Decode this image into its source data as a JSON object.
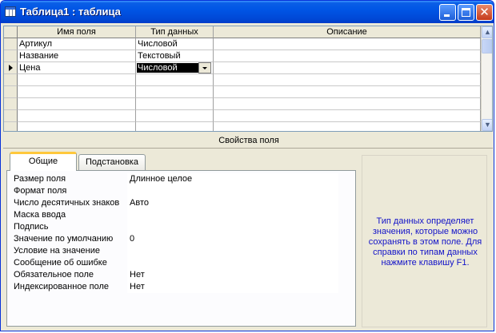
{
  "window": {
    "title": "Таблица1 : таблица"
  },
  "grid": {
    "headers": {
      "name": "Имя поля",
      "type": "Тип данных",
      "description": "Описание"
    },
    "rows": [
      {
        "name": "Артикул",
        "type": "Числовой",
        "description": ""
      },
      {
        "name": "Название",
        "type": "Текстовый",
        "description": ""
      },
      {
        "name": "Цена",
        "type": "Числовой",
        "description": ""
      }
    ],
    "current_row_index": 2
  },
  "properties": {
    "header": "Свойства поля",
    "tabs": [
      "Общие",
      "Подстановка"
    ],
    "active_tab": "Общие",
    "rows": [
      {
        "label": "Размер поля",
        "value": "Длинное целое"
      },
      {
        "label": "Формат поля",
        "value": ""
      },
      {
        "label": "Число десятичных знаков",
        "value": "Авто"
      },
      {
        "label": "Маска ввода",
        "value": ""
      },
      {
        "label": "Подпись",
        "value": ""
      },
      {
        "label": "Значение по умолчанию",
        "value": "0"
      },
      {
        "label": "Условие на значение",
        "value": ""
      },
      {
        "label": "Сообщение об ошибке",
        "value": ""
      },
      {
        "label": "Обязательное поле",
        "value": "Нет"
      },
      {
        "label": "Индексированное поле",
        "value": "Нет"
      }
    ],
    "help_text": "Тип данных определяет значения, которые можно сохранять в этом поле. Для справки по типам данных нажмите клавишу F1."
  },
  "colors": {
    "title_bar": "#0055e5",
    "help_text": "#1212c8",
    "selected_cell": "#000000"
  }
}
